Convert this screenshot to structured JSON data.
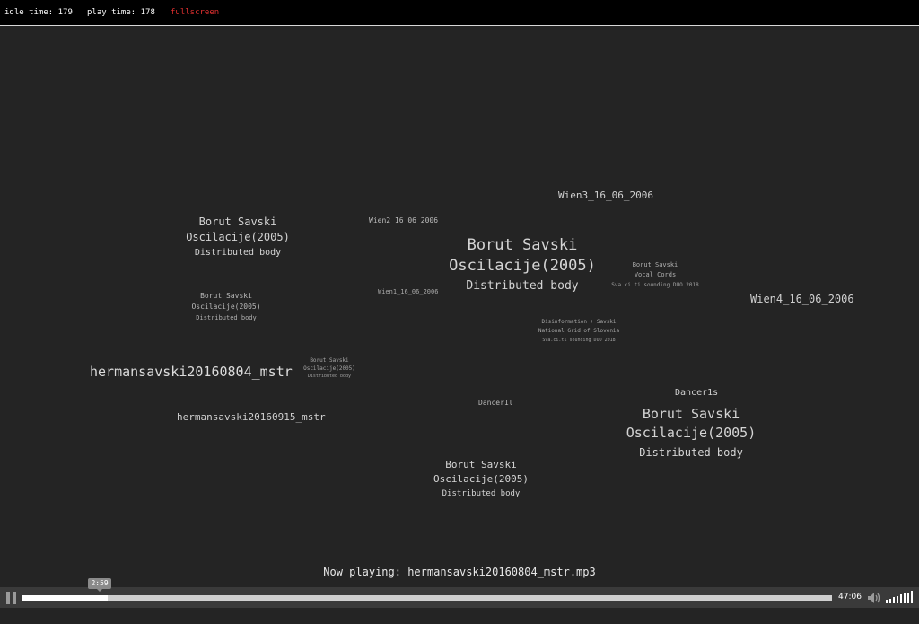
{
  "topbar": {
    "idle_label": "idle time: 179",
    "play_label": "play time: 178",
    "fullscreen_label": "fullscreen"
  },
  "tracks": {
    "wien3": "Wien3_16_06_2006",
    "wien2": "Wien2_16_06_2006",
    "wien1": "Wien1_16_06_2006",
    "wien4": "Wien4_16_06_2006",
    "herman1": "hermansavski20160804_mstr",
    "herman2": "hermansavski20160915_mstr",
    "dancer1": "Dancer1l",
    "dancer2": "Dancer1s"
  },
  "albums": {
    "a": {
      "artist": "Borut Savski",
      "title": "Oscilacije(2005)",
      "sub": "Distributed body"
    },
    "b": {
      "artist": "Borut Savski",
      "title": "Oscilacije(2005)",
      "sub": "Distributed body"
    },
    "c": {
      "artist": "Borut Savski",
      "title": "Oscilacije(2005)",
      "sub": "Distributed body"
    },
    "d": {
      "artist": "Borut Savski",
      "title": "Oscilacije(2005)",
      "sub": "Distributed body"
    },
    "e": {
      "artist": "Borut Savski",
      "title": "Oscilacije(2005)",
      "sub": "Distributed body"
    },
    "f": {
      "artist": "Borut Savski",
      "title": "Oscilacije(2005)",
      "sub": "Distributed body"
    },
    "vocal": {
      "artist": "Borut Savski",
      "title": "Vocal Cords",
      "sub": "Sva.ci.ti sounding DUO 2018"
    },
    "disinfo": {
      "artist": "Disinformation + Savski",
      "title": "National Grid of Slovenia",
      "sub": "Sva.ci.ti sounding DUO 2018"
    }
  },
  "now_playing": "Now playing: hermansavski20160804_mstr.mp3",
  "player": {
    "current_time": "2:59",
    "duration": "47:06",
    "progress": 0.105,
    "volume": 1.0
  },
  "colors": {
    "background": "#242424",
    "topbar": "#000000",
    "fullscreen": "#e03030",
    "text": "#d0d0d0"
  }
}
